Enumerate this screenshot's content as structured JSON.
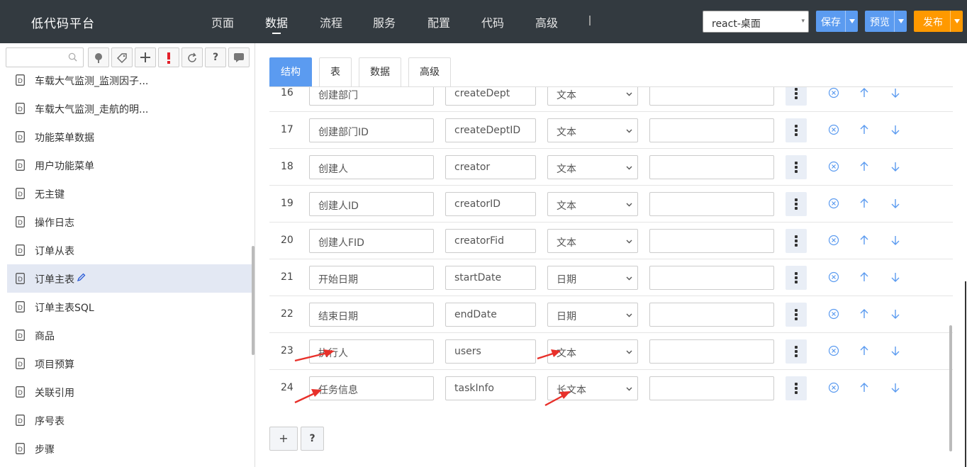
{
  "app": {
    "title": "低代码平台"
  },
  "nav": [
    {
      "label": "页面",
      "active": false
    },
    {
      "label": "数据",
      "active": true
    },
    {
      "label": "流程",
      "active": false
    },
    {
      "label": "服务",
      "active": false
    },
    {
      "label": "配置",
      "active": false
    },
    {
      "label": "代码",
      "active": false
    },
    {
      "label": "高级",
      "active": false
    }
  ],
  "top_right": {
    "project_select": "react-桌面",
    "save_label": "保存",
    "preview_label": "预览",
    "publish_label": "发布"
  },
  "colors": {
    "topbar": "#333a40",
    "primary": "#5b9bf0",
    "publish": "#ff9900",
    "link_icon": "#5b9bf0",
    "annotation": "#e8302a"
  },
  "sidebar": {
    "search_placeholder": "",
    "tools": [
      "tree-icon",
      "tag-icon",
      "plus-icon",
      "exclamation-icon",
      "refresh-icon",
      "help-icon",
      "comment-icon"
    ],
    "items": [
      {
        "label": "车载大气监测_监测因子...",
        "selected": false
      },
      {
        "label": "车载大气监测_走航的明...",
        "selected": false
      },
      {
        "label": "功能菜单数据",
        "selected": false
      },
      {
        "label": "用户功能菜单",
        "selected": false
      },
      {
        "label": "无主键",
        "selected": false
      },
      {
        "label": "操作日志",
        "selected": false
      },
      {
        "label": "订单从表",
        "selected": false
      },
      {
        "label": "订单主表",
        "selected": true
      },
      {
        "label": "订单主表SQL",
        "selected": false
      },
      {
        "label": "商品",
        "selected": false
      },
      {
        "label": "项目预算",
        "selected": false
      },
      {
        "label": "关联引用",
        "selected": false
      },
      {
        "label": "序号表",
        "selected": false
      },
      {
        "label": "步骤",
        "selected": false
      }
    ]
  },
  "tabs": [
    {
      "label": "结构",
      "active": true
    },
    {
      "label": "表",
      "active": false
    },
    {
      "label": "数据",
      "active": false
    },
    {
      "label": "高级",
      "active": false
    }
  ],
  "fields": [
    {
      "num": "16",
      "name": "创建部门",
      "code": "createDept",
      "type": "文本",
      "extra": ""
    },
    {
      "num": "17",
      "name": "创建部门ID",
      "code": "createDeptID",
      "type": "文本",
      "extra": ""
    },
    {
      "num": "18",
      "name": "创建人",
      "code": "creator",
      "type": "文本",
      "extra": ""
    },
    {
      "num": "19",
      "name": "创建人ID",
      "code": "creatorID",
      "type": "文本",
      "extra": ""
    },
    {
      "num": "20",
      "name": "创建人FID",
      "code": "creatorFid",
      "type": "文本",
      "extra": ""
    },
    {
      "num": "21",
      "name": "开始日期",
      "code": "startDate",
      "type": "日期",
      "extra": ""
    },
    {
      "num": "22",
      "name": "结束日期",
      "code": "endDate",
      "type": "日期",
      "extra": ""
    },
    {
      "num": "23",
      "name": "执行人",
      "code": "users",
      "type": "文本",
      "extra": ""
    },
    {
      "num": "24",
      "name": "任务信息",
      "code": "taskInfo",
      "type": "长文本",
      "extra": ""
    }
  ],
  "footer": {
    "add_label": "+",
    "help_label": "?"
  }
}
